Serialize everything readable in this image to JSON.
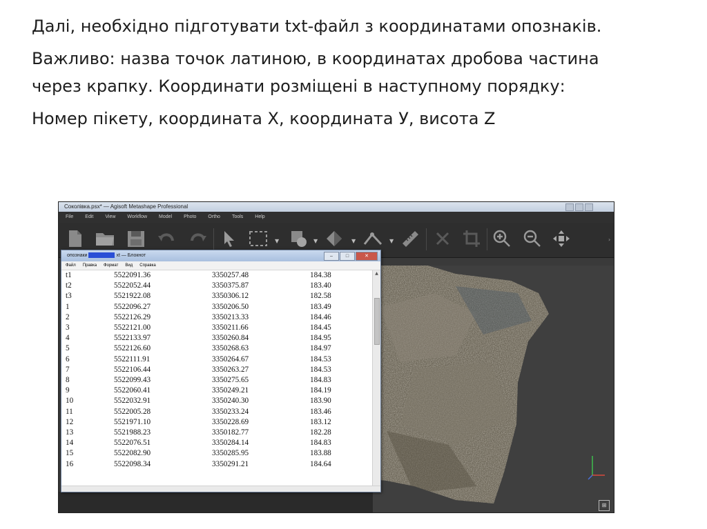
{
  "slide": {
    "paragraphs": [
      "Далі, необхідно підготувати txt-файл з координатами опознаків.",
      "Важливо: назва точок латиною, в координатах дробова частина через крапку. Координати розміщені в наступному порядку:",
      "Номер  пікету, координата X, координата У, висота Z"
    ]
  },
  "app": {
    "title": "Соколівка.psx* — Agisoft Metashape Professional",
    "menu": [
      "File",
      "Edit",
      "View",
      "Workflow",
      "Model",
      "Photo",
      "Ortho",
      "Tools",
      "Help"
    ],
    "toolbar_icons": [
      "new-document-icon",
      "open-folder-icon",
      "save-icon",
      "undo-icon",
      "redo-icon",
      "pointer-icon",
      "rectangle-select-icon",
      "paint-select-icon",
      "shape-icon",
      "ruler-icon",
      "delete-icon",
      "crop-icon",
      "zoom-in-icon",
      "zoom-out-icon",
      "move-icon"
    ]
  },
  "notepad": {
    "title_prefix": "опознаки",
    "title_suffix": "xt — Блокнот",
    "menu": [
      "Файл",
      "Правка",
      "Формат",
      "Вид",
      "Справка"
    ],
    "rows": [
      [
        "t1",
        "5522091.36",
        "3350257.48",
        "184.38"
      ],
      [
        "t2",
        "5522052.44",
        "3350375.87",
        "183.40"
      ],
      [
        "t3",
        "5521922.08",
        "3350306.12",
        "182.58"
      ],
      [
        "1",
        "5522096.27",
        "3350206.50",
        "183.49"
      ],
      [
        "2",
        "5522126.29",
        "3350213.33",
        "184.46"
      ],
      [
        "3",
        "5522121.00",
        "3350211.66",
        "184.45"
      ],
      [
        "4",
        "5522133.97",
        "3350260.84",
        "184.95"
      ],
      [
        "5",
        "5522126.60",
        "3350268.63",
        "184.97"
      ],
      [
        "6",
        "5522111.91",
        "3350264.67",
        "184.53"
      ],
      [
        "7",
        "5522106.44",
        "3350263.27",
        "184.53"
      ],
      [
        "8",
        "5522099.43",
        "3350275.65",
        "184.83"
      ],
      [
        "9",
        "5522060.41",
        "3350249.21",
        "184.19"
      ],
      [
        "10",
        "5522032.91",
        "3350240.30",
        "183.90"
      ],
      [
        "11",
        "5522005.28",
        "3350233.24",
        "183.46"
      ],
      [
        "12",
        "5521971.10",
        "3350228.69",
        "183.12"
      ],
      [
        "13",
        "5521988.23",
        "3350182.77",
        "182.28"
      ],
      [
        "14",
        "5522076.51",
        "3350284.14",
        "184.83"
      ],
      [
        "15",
        "5522082.90",
        "3350285.95",
        "183.88"
      ],
      [
        "16",
        "5522098.34",
        "3350291.21",
        "184.64"
      ]
    ]
  }
}
